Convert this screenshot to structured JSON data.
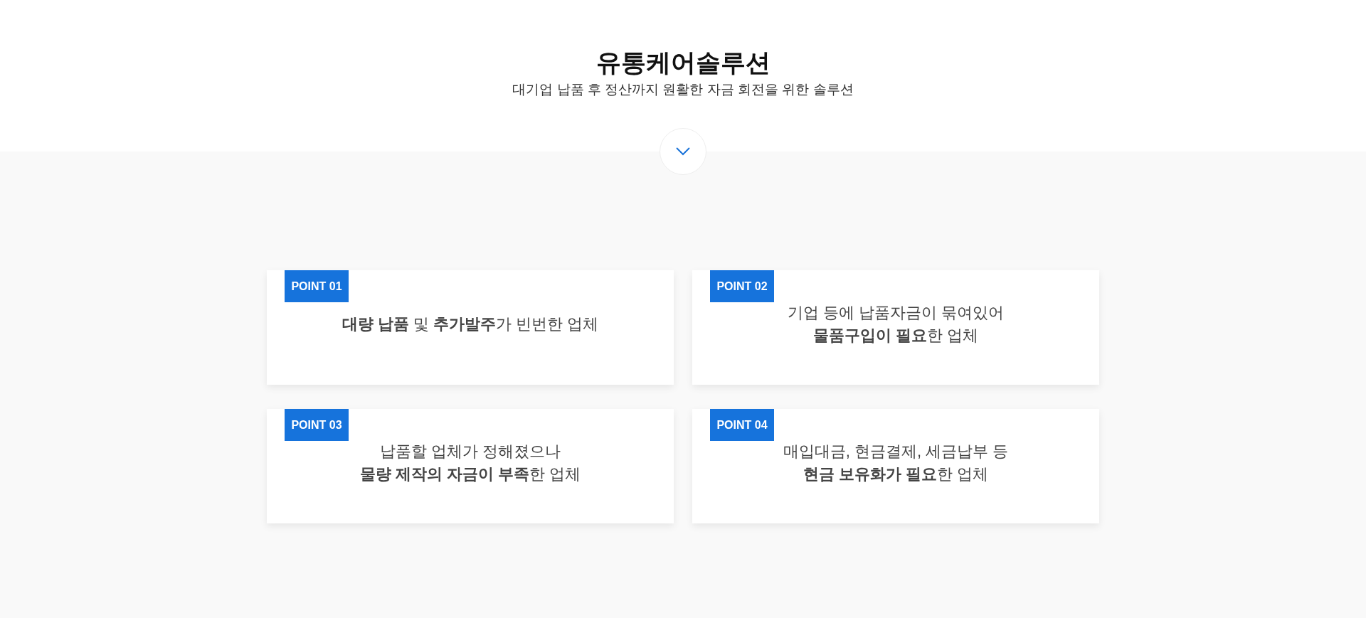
{
  "header": {
    "title": "유통케어솔루션",
    "subtitle": "대기업 납품 후 정산까지 원활한 자금 회전을 위한 솔루션"
  },
  "points": [
    {
      "badge": "POINT 01",
      "lines": [
        "**대량 납품** 및 **추가발주**가 빈번한 업체"
      ]
    },
    {
      "badge": "POINT 02",
      "lines": [
        "기업 등에 납품자금이 묶여있어",
        "**물품구입이 필요**한 업체"
      ]
    },
    {
      "badge": "POINT 03",
      "lines": [
        "납품할 업체가 정해졌으나",
        "**물량 제작의 자금이 부족**한 업체"
      ]
    },
    {
      "badge": "POINT 04",
      "lines": [
        "매입대금, 현금결제, 세금납부 등",
        "**현금 보유화가 필요**한 업체"
      ]
    }
  ]
}
